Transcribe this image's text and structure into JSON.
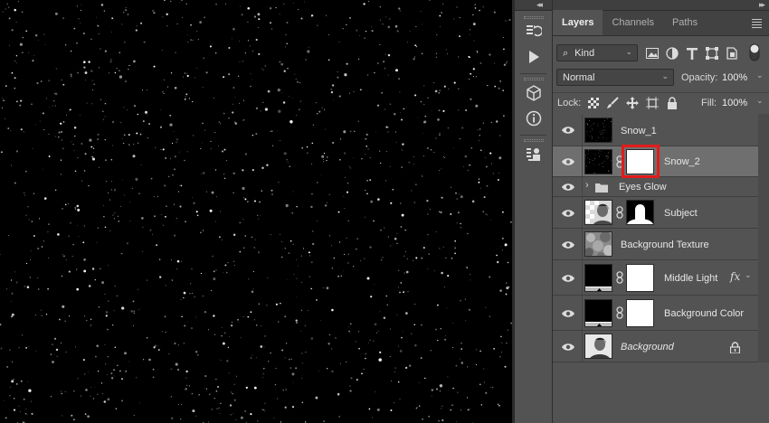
{
  "panel": {
    "tabs": [
      {
        "label": "Layers",
        "active": true
      },
      {
        "label": "Channels",
        "active": false
      },
      {
        "label": "Paths",
        "active": false
      }
    ],
    "filter": {
      "label": "Kind"
    },
    "blend_mode": "Normal",
    "opacity_label": "Opacity:",
    "opacity_value": "100%",
    "lock_label": "Lock:",
    "fill_label": "Fill:",
    "fill_value": "100%"
  },
  "layers": [
    {
      "name": "Snow_1",
      "visible": true,
      "thumb": "snow",
      "mask": false
    },
    {
      "name": "Snow_2",
      "visible": true,
      "thumb": "snow",
      "mask": true,
      "selected": true,
      "mask_highlighted": true
    },
    {
      "name": "Eyes Glow",
      "visible": true,
      "type": "group"
    },
    {
      "name": "Subject",
      "visible": true,
      "thumb": "portrait",
      "mask": true
    },
    {
      "name": "Background Texture",
      "visible": true,
      "thumb": "texture",
      "mask": false
    },
    {
      "name": "Middle Light",
      "visible": true,
      "thumb": "adjustment",
      "mask": true,
      "fx": "fx"
    },
    {
      "name": "Background Color",
      "visible": true,
      "thumb": "adjustment",
      "mask": true
    },
    {
      "name": "Background",
      "visible": true,
      "thumb": "portrait",
      "mask": false,
      "locked": true,
      "italic": true
    }
  ],
  "colors": {
    "panel_bg": "#535353",
    "selected_row": "#6f6f6f",
    "highlight": "#e21b1b"
  }
}
